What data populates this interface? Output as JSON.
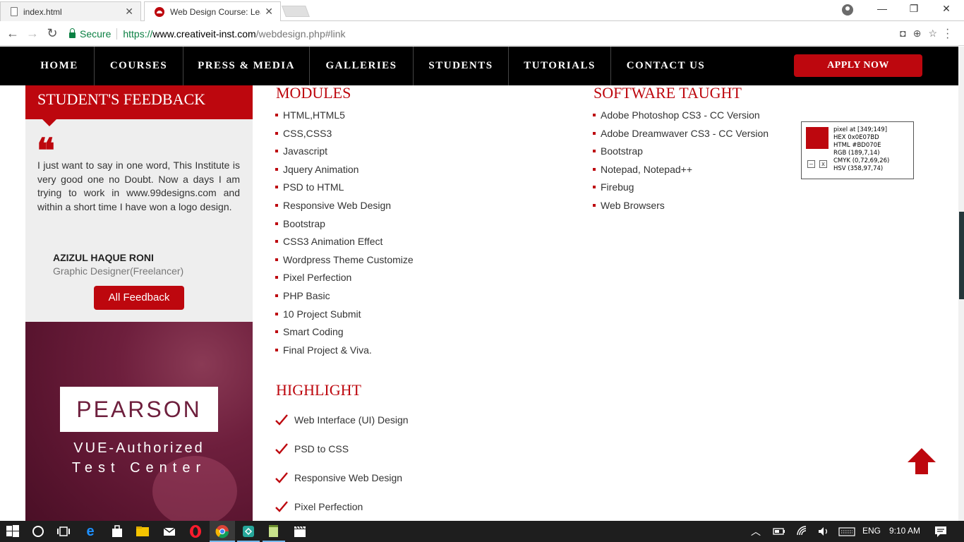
{
  "browser": {
    "tabs": [
      {
        "title": "index.html",
        "icon": "document-icon",
        "active": false
      },
      {
        "title": "Web Design Course: Lear",
        "icon": "creative-it-favicon",
        "active": true
      }
    ],
    "close_glyph": "✕",
    "window_controls": {
      "minimize": "—",
      "restore": "❐",
      "close": "✕"
    },
    "address": {
      "secure_label": "Secure",
      "url_protocol": "https://",
      "url_host": "www.creativeit-inst.com",
      "url_path": "/webdesign.php#link"
    }
  },
  "nav": {
    "items": [
      "HOME",
      "COURSES",
      "PRESS & MEDIA",
      "GALLERIES",
      "STUDENTS",
      "TUTORIALS",
      "CONTACT US"
    ],
    "apply_label": "APPLY NOW"
  },
  "feedback": {
    "title": "STUDENT'S FEEDBACK",
    "quote_glyph": "❝",
    "text": "I just want to say in one word, This Institute is very good one no Doubt. Now a days I am trying to work in www.99designs.com and within a short time I have won a logo design.",
    "author": "AZIZUL HAQUE RONI",
    "role": "Graphic Designer(Freelancer)",
    "button_label": "All Feedback"
  },
  "pearson": {
    "logo": "PEARSON",
    "line1": "VUE-Authorized",
    "line2": "Test Center"
  },
  "modules": {
    "title": "MODULES",
    "items": [
      "HTML,HTML5",
      "CSS,CSS3",
      "Javascript",
      "Jquery Animation",
      "PSD to HTML",
      "Responsive Web Design",
      "Bootstrap",
      "CSS3 Animation Effect",
      "Wordpress Theme Customize",
      "Pixel Perfection",
      "PHP Basic",
      "10 Project Submit",
      "Smart Coding",
      "Final Project & Viva."
    ]
  },
  "software": {
    "title": "SOFTWARE TAUGHT",
    "items": [
      "Adobe Photoshop CS3 - CC Version",
      "Adobe Dreamwaver CS3 - CC Version",
      "Bootstrap",
      "Notepad, Notepad++",
      "Firebug",
      "Web Browsers"
    ]
  },
  "highlight": {
    "title": "HIGHLIGHT",
    "items": [
      "Web Interface (UI) Design",
      "PSD to CSS",
      "Responsive Web Design",
      "Pixel Perfection"
    ]
  },
  "color_picker": {
    "lines": [
      "pixel at [349;149]",
      "HEX 0x0E07BD",
      "HTML #BD070E",
      "RGB (189,7,14)",
      "CMYK (0,72,69,26)",
      "HSV (358,97,74)"
    ],
    "minimize": "–",
    "close": "x"
  },
  "taskbar": {
    "language": "ENG",
    "time": "9:10 AM"
  },
  "colors": {
    "brand_red": "#bd070e",
    "nav_bg": "#000000",
    "panel_bg": "#eeeeee"
  }
}
